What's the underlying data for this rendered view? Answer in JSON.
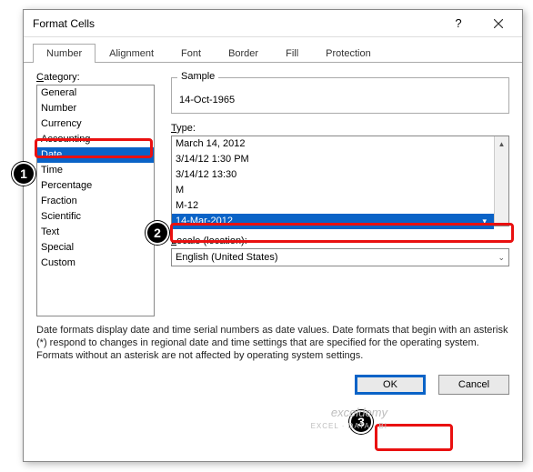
{
  "dialog": {
    "title": "Format Cells",
    "help": "?",
    "tabs": [
      "Number",
      "Alignment",
      "Font",
      "Border",
      "Fill",
      "Protection"
    ],
    "active_tab": 0,
    "category_label": "Category:",
    "categories": [
      "General",
      "Number",
      "Currency",
      "Accounting",
      "Date",
      "Time",
      "Percentage",
      "Fraction",
      "Scientific",
      "Text",
      "Special",
      "Custom"
    ],
    "selected_category_index": 4,
    "sample_label": "Sample",
    "sample_value": "14-Oct-1965",
    "type_label": "Type:",
    "types": [
      "March 14, 2012",
      "3/14/12 1:30 PM",
      "3/14/12 13:30",
      "M",
      "M-12",
      "14-Mar-2012"
    ],
    "selected_type_index": 5,
    "locale_label": "Locale (location):",
    "locale_value": "English (United States)",
    "description": "Date formats display date and time serial numbers as date values.  Date formats that begin with an asterisk (*) respond to changes in regional date and time settings that are specified for the operating system. Formats without an asterisk are not affected by operating system settings.",
    "ok_label": "OK",
    "cancel_label": "Cancel"
  },
  "annotations": {
    "callouts": [
      "1",
      "2",
      "3"
    ],
    "watermark": "exceldemy",
    "watermark_sub": "EXCEL · DATA · BI"
  }
}
